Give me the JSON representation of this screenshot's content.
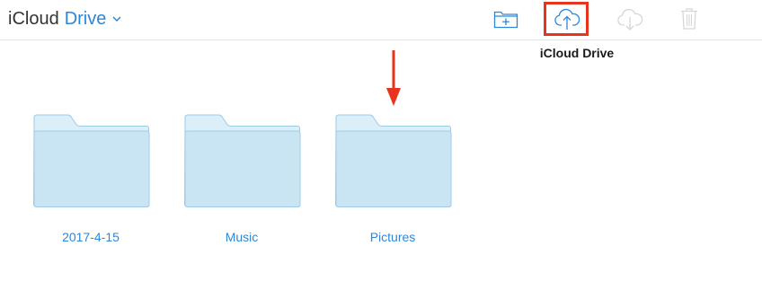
{
  "header": {
    "brand": "iCloud",
    "title": "Drive"
  },
  "toolbar": {
    "tooltip": "iCloud Drive",
    "highlight_color": "#e8341c",
    "buttons": [
      {
        "name": "new-folder",
        "icon": "folder-plus-icon",
        "enabled": true
      },
      {
        "name": "upload",
        "icon": "cloud-upload-icon",
        "enabled": true
      },
      {
        "name": "download",
        "icon": "cloud-download-icon",
        "enabled": false
      },
      {
        "name": "delete",
        "icon": "trash-icon",
        "enabled": false
      }
    ]
  },
  "folders": [
    {
      "name": "2017-4-15"
    },
    {
      "name": "Music"
    },
    {
      "name": "Pictures"
    }
  ],
  "colors": {
    "accent": "#2e86d8",
    "folder_fill": "#c9e4f3",
    "folder_stroke": "#9fcbe4",
    "disabled": "#d6d6d6"
  }
}
